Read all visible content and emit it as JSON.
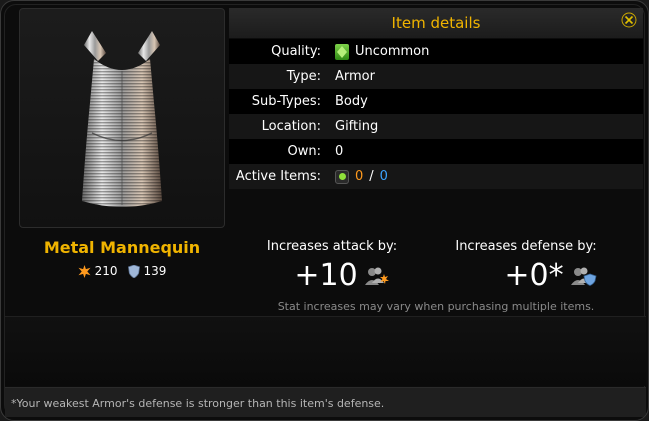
{
  "header": {
    "title": "Item details"
  },
  "item": {
    "name": "Metal Mannequin",
    "attack": "210",
    "defense": "139"
  },
  "details": [
    {
      "label": "Quality:",
      "value": "Uncommon"
    },
    {
      "label": "Type:",
      "value": "Armor"
    },
    {
      "label": "Sub-Types:",
      "value": "Body"
    },
    {
      "label": "Location:",
      "value": "Gifting"
    },
    {
      "label": "Own:",
      "value": "0"
    },
    {
      "label": "Active Items:",
      "value_owned": "0",
      "separator": "/",
      "value_total": "0"
    }
  ],
  "increases": {
    "attack_label": "Increases attack by:",
    "attack_value": "+10",
    "defense_label": "Increases defense by:",
    "defense_value": "+0*",
    "note": "Stat increases may vary when purchasing multiple items."
  },
  "footer": {
    "text": "*Your weakest Armor's defense is stronger than this item's defense."
  },
  "colors": {
    "accent": "#f0b400",
    "orange": "#ff9a1e",
    "blue": "#3ba3ff",
    "gem": "#5cb82e"
  }
}
